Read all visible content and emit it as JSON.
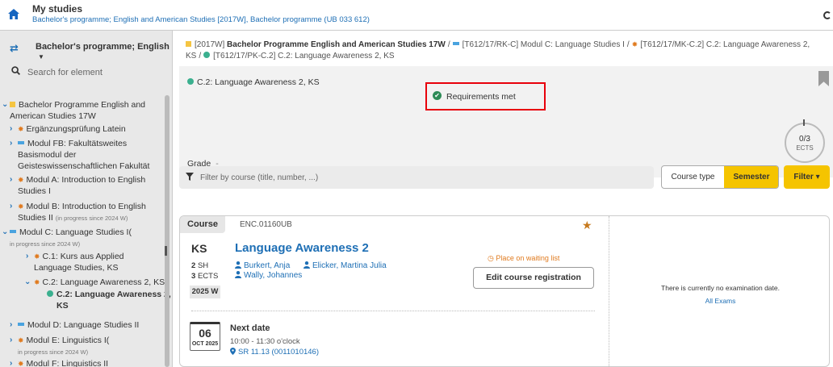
{
  "topbar": {
    "title": "My studies",
    "subtitle": "Bachelor's programme; English and American Studies [2017W], Bachelor programme (UB 033 612)"
  },
  "sidebar": {
    "programme": "Bachelor's programme; English",
    "search_placeholder": "Search for element",
    "tree": {
      "root": "Bachelor Programme English and American Studies 17W",
      "latin": "Ergänzungsprüfung Latein",
      "fb_1": "Modul FB: Fakultätsweites",
      "fb_2": "Basismodul der",
      "fb_3": "Geisteswissenschaftlichen Fakultät",
      "a_1": "Modul A: Introduction to English",
      "a_2": "Studies I",
      "b_1": "Modul B: Introduction to English",
      "b_2": "Studies II",
      "b_note": "(in progress since 2024 W)",
      "c_1": "Modul C: Language Studies I",
      "c_note_open": "(",
      "c_note": "in progress since 2024 W)",
      "c1_1": "C.1: Kurs aus Applied",
      "c1_2": "Language Studies, KS",
      "c2": "C.2: Language Awareness 2, KS",
      "c2_sel_1": "C.2: Language Awareness 2,",
      "c2_sel_2": "KS",
      "d": "Modul D: Language Studies II",
      "e": "Modul E: Linguistics I",
      "e_note_open": "(",
      "e_note": "in progress since 2024 W)",
      "f": "Modul F: Linguistics II"
    }
  },
  "breadcrumb": {
    "code_1": "[2017W]",
    "name_1": "Bachelor Programme English and American Studies 17W",
    "code_2": "[T612/17/RK-C]",
    "name_2": "Modul C: Language Studies I",
    "code_3": "[T612/17/MK-C.2]",
    "name_3": "C.2: Language Awareness 2,",
    "name_3b": "KS",
    "code_4": "[T612/17/PK-C.2]",
    "name_4": "C.2: Language Awareness 2, KS",
    "sep": "/"
  },
  "summary": {
    "title": "C.2: Language Awareness 2, KS",
    "requirements": "Requirements met",
    "grade_label": "Grade",
    "grade_value": "-",
    "ects_value": "0/3",
    "ects_label": "ECTS"
  },
  "filter": {
    "placeholder": "Filter by course (title, number, ...)",
    "course_type": "Course type",
    "semester": "Semester",
    "filter_btn": "Filter ▾"
  },
  "course": {
    "tag": "Course",
    "number": "ENC.01160UB",
    "type": "KS",
    "title": "Language Awareness 2",
    "sh_num": "2",
    "sh_unit": "SH",
    "ects_num": "3",
    "ects_unit": "ECTS",
    "semester": "2025 W",
    "lecturers": [
      "Burkert, Anja",
      "Elicker, Martina Julia",
      "Wally, Johannes"
    ],
    "waiting": "Place on waiting list",
    "edit_btn": "Edit course registration",
    "next_label": "Next date",
    "date_day": "06",
    "date_month": "OCT 2025",
    "next_time": "10:00 - 11:30 o'clock",
    "room": "SR 11.13 (0011010146)",
    "no_exam": "There is currently no examination date.",
    "all_exams": "All Exams"
  },
  "colors": {
    "accent_blue": "#1e6fb5",
    "yellow": "#f5c400",
    "highlight_red": "#e8000b",
    "green": "#2e8b57"
  }
}
